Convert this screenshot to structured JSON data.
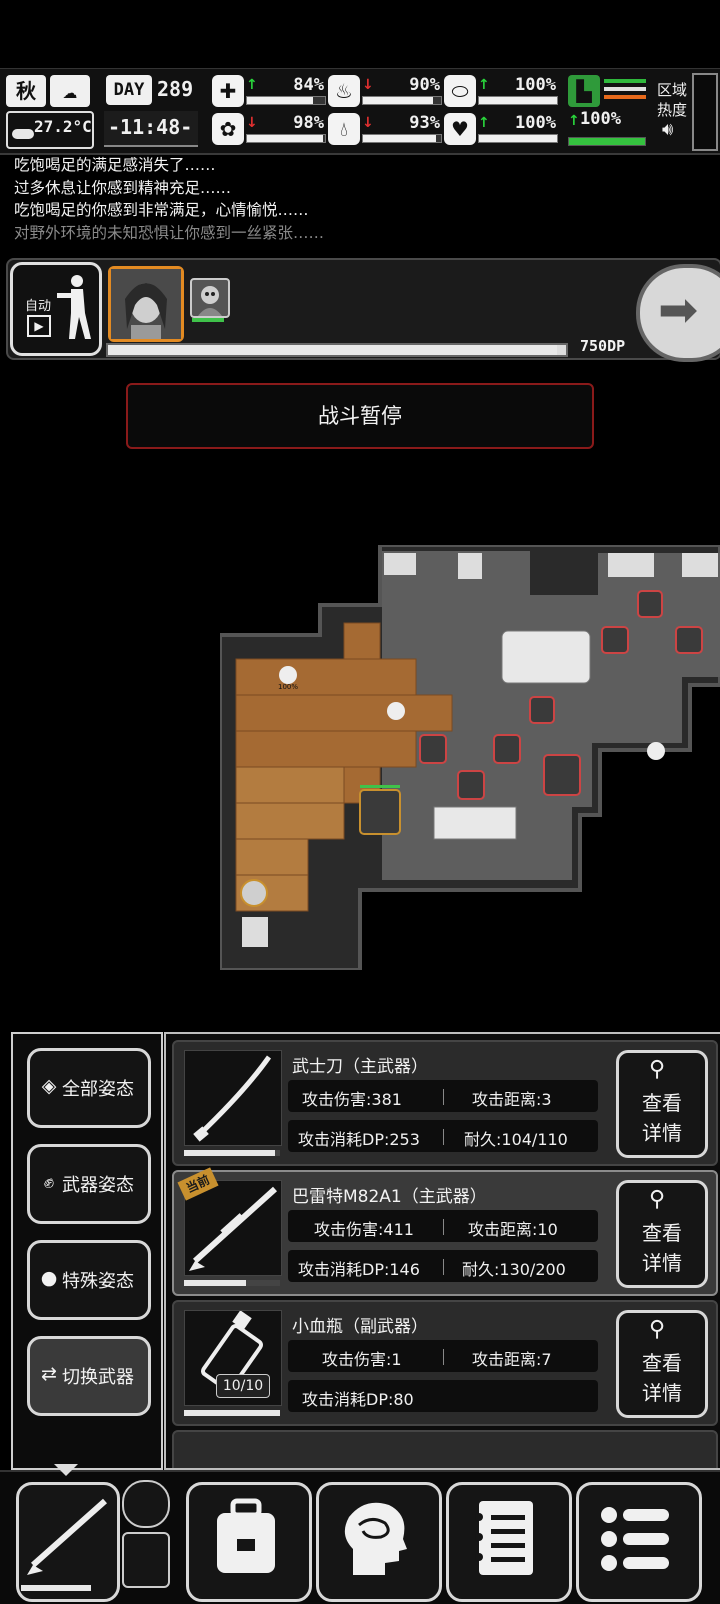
{
  "status": {
    "season": "秋",
    "temperature": "27.2°C",
    "day_label": "DAY",
    "day_number": "289",
    "time": "-11:48-",
    "stats": [
      {
        "icon": "medkit-icon",
        "trend": "up",
        "value": "84%",
        "fill": 0.84
      },
      {
        "icon": "stomach-icon",
        "trend": "down",
        "value": "90%",
        "fill": 0.9
      },
      {
        "icon": "pill-icon",
        "trend": "up",
        "value": "100%",
        "fill": 1.0
      },
      {
        "icon": "brain-icon",
        "trend": "down",
        "value": "98%",
        "fill": 0.98
      },
      {
        "icon": "water-drop-icon",
        "trend": "down",
        "value": "93%",
        "fill": 0.93
      },
      {
        "icon": "heart-icon",
        "trend": "up",
        "value": "100%",
        "fill": 1.0
      }
    ],
    "stamina": {
      "trend": "up",
      "value": "100%",
      "fill": 1.0
    },
    "region_label_1": "区域",
    "region_label_2": "热度"
  },
  "log": [
    "吃饱喝足的满足感消失了……",
    "过多休息让你感到精神充足……",
    "吃饱喝足的你感到非常满足，心情愉悦……",
    "对野外环境的未知恐惧让你感到一丝紧张……"
  ],
  "party": {
    "auto_label": "自动",
    "dp_value": "750DP",
    "dp_fill": 0.98
  },
  "battle": {
    "pause_label": "战斗暂停"
  },
  "map_labels": {
    "percent": "100%"
  },
  "stances": [
    {
      "name": "all",
      "label": "全部姿态",
      "icon": "layers-icon"
    },
    {
      "name": "weapon",
      "label": "武器姿态",
      "icon": "fist-icon"
    },
    {
      "name": "special",
      "label": "特殊姿态",
      "icon": "grenade-icon"
    },
    {
      "name": "swap",
      "label": "切换武器",
      "icon": "swap-icon"
    }
  ],
  "weapons": [
    {
      "name": "武士刀（主武器）",
      "attack_damage": "攻击伤害:381",
      "attack_range": "攻击距离:3",
      "dp_cost": "攻击消耗DP:253",
      "durability": "耐久:104/110",
      "durability_fill": 0.95,
      "current": false
    },
    {
      "name": "巴雷特M82A1（主武器）",
      "attack_damage": "攻击伤害:411",
      "attack_range": "攻击距离:10",
      "dp_cost": "攻击消耗DP:146",
      "durability": "耐久:130/200",
      "durability_fill": 0.65,
      "current": true,
      "current_tag": "当前"
    },
    {
      "name": "小血瓶（副武器）",
      "attack_damage": "攻击伤害:1",
      "attack_range": "攻击距离:7",
      "dp_cost": "攻击消耗DP:80",
      "ammo": "10/10",
      "durability_fill": 1.0,
      "current": false
    }
  ],
  "detail_label_1": "查看",
  "detail_label_2": "详情",
  "bottom_nav": [
    "weapon-slot",
    "backpack",
    "skills-brain",
    "journal",
    "menu"
  ]
}
